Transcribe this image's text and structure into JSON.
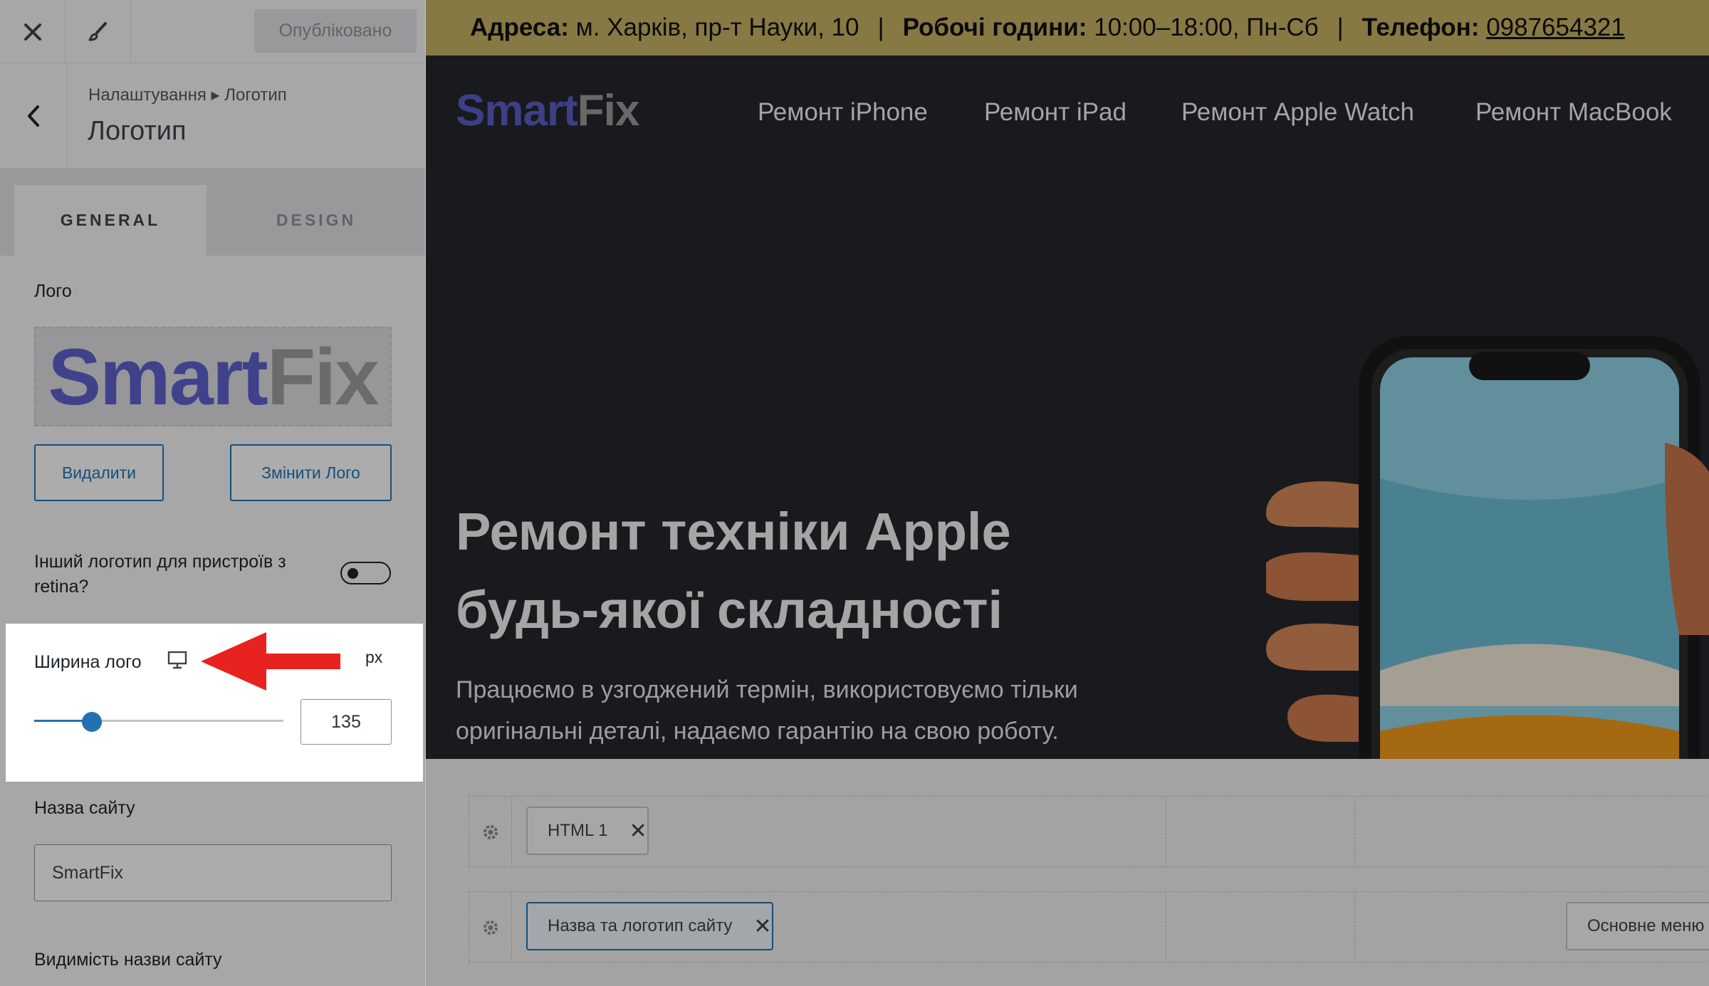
{
  "colors": {
    "accent": "#2271b1",
    "logo_smart": "#5b5fc7",
    "logo_fix": "#9a9a9a",
    "topbar": "#c8b365",
    "hero_bg": "#25272d",
    "arrow": "#e8231f"
  },
  "panel": {
    "publish_label": "Опубліковано",
    "breadcrumb": "Налаштування ▸ Логотип",
    "title": "Логотип",
    "tabs": [
      {
        "label": "GENERAL",
        "active": true
      },
      {
        "label": "DESIGN",
        "active": false
      }
    ],
    "logo_label": "Лого",
    "logo_preview": {
      "part1": "Smart",
      "part2": "Fix"
    },
    "remove_button": "Видалити",
    "change_button": "Змінити Лого",
    "retina_label": "Інший логотип для пристроїв з retina?",
    "retina_enabled": false,
    "width": {
      "label": "Ширина лого",
      "unit": "px",
      "value": "135",
      "slider_fraction": 0.23
    },
    "site_name_label": "Назва сайту",
    "site_name_value": "SmartFix",
    "site_visibility_label": "Видимість назви сайту",
    "icons": [
      "close-icon",
      "brush-icon",
      "back-chevron-icon",
      "monitor-icon"
    ]
  },
  "preview": {
    "topbar": {
      "address_label": "Адреса:",
      "address_value": "м. Харків, пр-т Науки, 10",
      "hours_label": "Робочі години:",
      "hours_value": "10:00–18:00, Пн-Сб",
      "phone_label": "Телефон:",
      "phone_value": "0987654321",
      "separator": "|"
    },
    "logo": {
      "part1": "Smart",
      "part2": "Fix"
    },
    "nav": [
      "Ремонт iPhone",
      "Ремонт iPad",
      "Ремонт Apple Watch",
      "Ремонт MacBook"
    ],
    "hero": {
      "title_line1": "Ремонт техніки Apple",
      "title_line2": "будь-якої складності",
      "text": "Працюємо в узгоджений термін, використовуємо тільки оригінальні деталі, надаємо гарантію на свою роботу."
    },
    "builder": {
      "row1_chip": "HTML 1",
      "row2_chip": "Назва та логотип сайту",
      "row2_right_chip": "Основне меню"
    }
  }
}
